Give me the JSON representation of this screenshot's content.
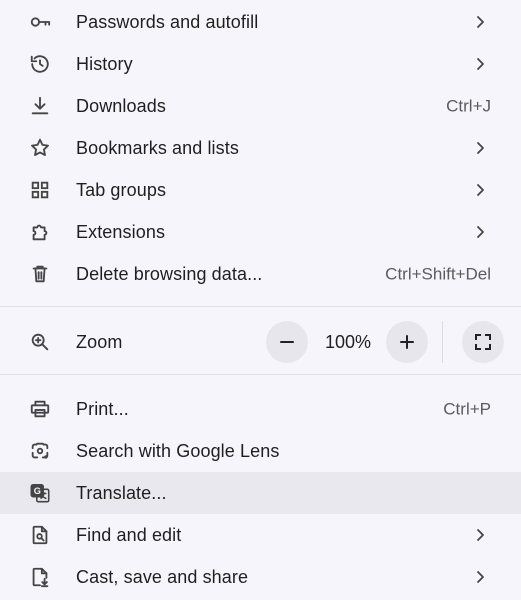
{
  "menu": {
    "items_top": [
      {
        "label": "Passwords and autofill",
        "icon": "key-icon",
        "chevron": true
      },
      {
        "label": "History",
        "icon": "history-icon",
        "chevron": true
      },
      {
        "label": "Downloads",
        "icon": "download-icon",
        "shortcut": "Ctrl+J"
      },
      {
        "label": "Bookmarks and lists",
        "icon": "star-icon",
        "chevron": true
      },
      {
        "label": "Tab groups",
        "icon": "tab-groups-icon",
        "chevron": true
      },
      {
        "label": "Extensions",
        "icon": "puzzle-icon",
        "chevron": true
      },
      {
        "label": "Delete browsing data...",
        "icon": "trash-icon",
        "shortcut": "Ctrl+Shift+Del"
      }
    ],
    "zoom": {
      "label": "Zoom",
      "icon": "zoom-icon",
      "value": "100%",
      "decrease_icon": "minus-icon",
      "increase_icon": "plus-icon",
      "fullscreen_icon": "fullscreen-icon"
    },
    "items_bottom": [
      {
        "label": "Print...",
        "icon": "print-icon",
        "shortcut": "Ctrl+P"
      },
      {
        "label": "Search with Google Lens",
        "icon": "google-lens-icon"
      },
      {
        "label": "Translate...",
        "icon": "translate-icon",
        "highlighted": true
      },
      {
        "label": "Find and edit",
        "icon": "find-page-icon",
        "chevron": true
      },
      {
        "label": "Cast, save and share",
        "icon": "cast-save-share-icon",
        "chevron": true
      }
    ]
  },
  "colors": {
    "background": "#f6f5fb",
    "highlight": "#e9e8ee",
    "text": "#1f1f1f",
    "shortcut_text": "#5c5c5c",
    "separator": "#d9e3ea",
    "zoom_button": "#e7e6ec"
  }
}
